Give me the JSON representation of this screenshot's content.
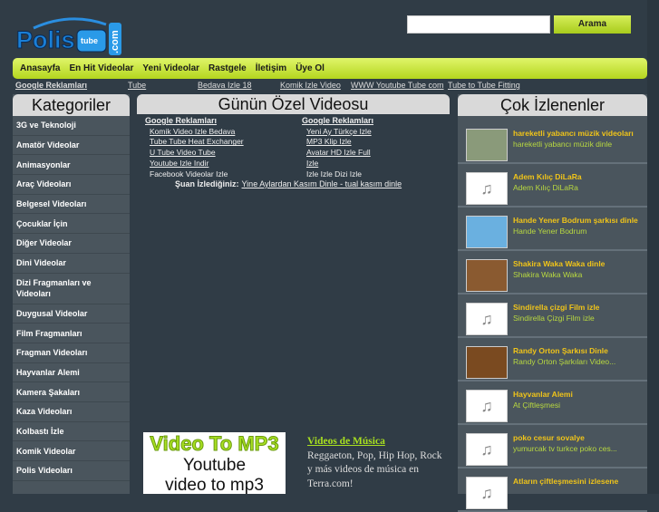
{
  "logo": {
    "text": "Polis tube .com"
  },
  "search": {
    "placeholder": "",
    "button": "Arama"
  },
  "nav": [
    "Anasayfa",
    "En Hit Videolar",
    "Yeni Videolar",
    "Rastgele",
    "İletişim",
    "Üye Ol"
  ],
  "ad_row": [
    "Google Reklamları",
    "Tube",
    "Bedava Izle 18",
    "Komik Izle Video",
    "WWW Youtube Tube com",
    "Tube to Tube Fitting"
  ],
  "left": {
    "title": "Kategoriler",
    "items": [
      "3G ve Teknoloji",
      "Amatör Videolar",
      "Animasyonlar",
      "Araç Videoları",
      "Belgesel Videoları",
      "Çocuklar İçin",
      "Diğer Videolar",
      "Dini Videolar",
      "Dizi Fragmanları ve Videoları",
      "Duygusal Videolar",
      "Film Fragmanları",
      "Fragman Videoları",
      "Hayvanlar Alemi",
      "Kamera Şakaları",
      "Kaza Videoları",
      "Kolbastı İzle",
      "Komik Videolar",
      "Polis Videoları"
    ]
  },
  "center": {
    "title": "Günün Özel Videosu",
    "col1": {
      "head": "Google Reklamları",
      "links": [
        "Komik Video Izle Bedava",
        "Tube Tube Heat Exchanger",
        "U Tube Video Tube",
        "Youtube Izle Indir",
        "Facebook Videolar Izle"
      ]
    },
    "col2": {
      "head": "Google Reklamları",
      "links": [
        "Yeni Ay Türkçe Izle",
        "MP3 Klip Izle",
        "Avatar HD Izle Full",
        "Izle",
        "Izle Izle Dizi Izle"
      ]
    },
    "now_label": "Şuan İzlediğiniz:",
    "now_value": "Yine Aylardan Kasım Dinle - tual kasım dinle",
    "ad_mp3": {
      "line1": "Video To MP3",
      "line2": "Youtube",
      "line3": "video to mp3"
    },
    "terra": {
      "title": "Videos de Música",
      "body": "Reggaeton, Pop, Hip Hop, Rock y más videos de música en Terra.com!"
    }
  },
  "right": {
    "title": "Çok İzlenenler",
    "items": [
      {
        "title": "hareketli yabancı müzik videoları",
        "sub": "hareketli yabancı müzik dinle"
      },
      {
        "title": "Adem Kılıç DiLaRa",
        "sub": "Adem Kılıç DiLaRa"
      },
      {
        "title": "Hande Yener Bodrum şarkısı dinle",
        "sub": "Hande Yener Bodrum"
      },
      {
        "title": "Shakira Waka Waka dinle",
        "sub": "Shakira Waka Waka"
      },
      {
        "title": "Sindirella çizgi Film izle",
        "sub": "Sindirella Çizgi Film izle"
      },
      {
        "title": "Randy Orton Şarkısı Dinle",
        "sub": "Randy Orton Şarkıları Video..."
      },
      {
        "title": "Hayvanlar Alemi",
        "sub": "At Çiftleşmesi"
      },
      {
        "title": "poko cesur sovalye",
        "sub": "yumurcak tv turkce poko ces..."
      },
      {
        "title": "Atların çiftleşmesini izlesene",
        "sub": ""
      }
    ]
  }
}
